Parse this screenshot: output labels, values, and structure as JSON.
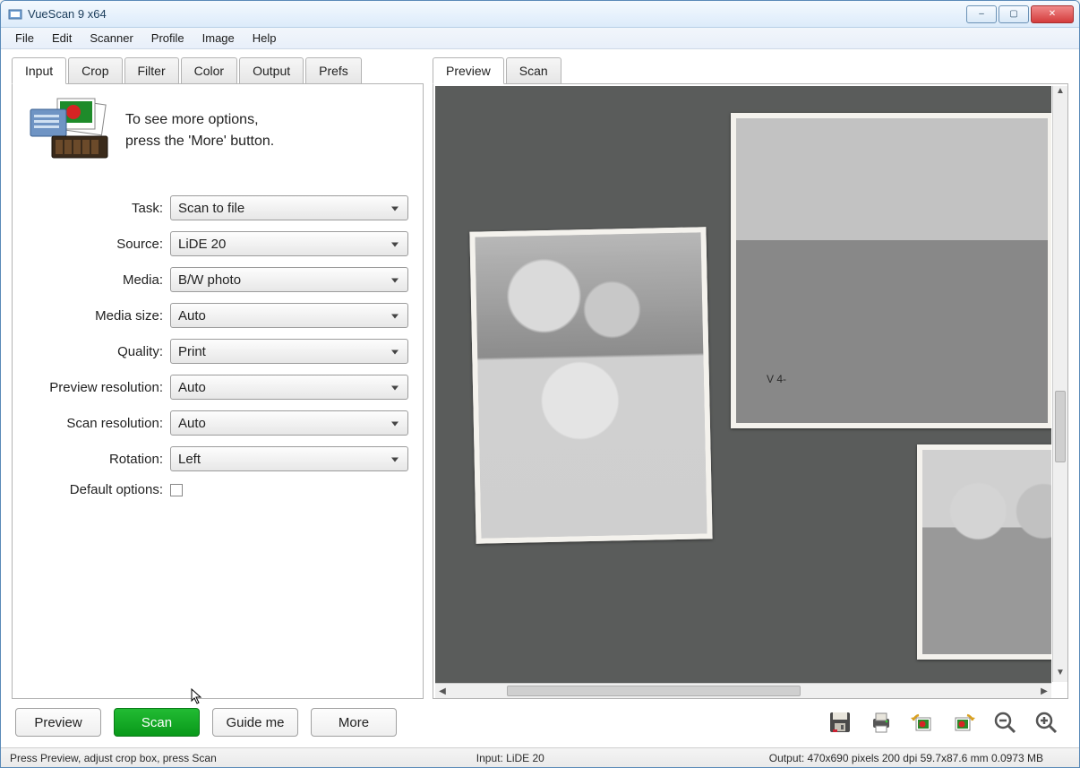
{
  "window": {
    "title": "VueScan 9 x64",
    "controls": {
      "minimize": "–",
      "maximize": "▢",
      "close": "✕"
    }
  },
  "menu": [
    "File",
    "Edit",
    "Scanner",
    "Profile",
    "Image",
    "Help"
  ],
  "left": {
    "tabs": [
      "Input",
      "Crop",
      "Filter",
      "Color",
      "Output",
      "Prefs"
    ],
    "active_tab": 0,
    "hint_line1": "To see more options,",
    "hint_line2": "press the 'More' button.",
    "fields": {
      "task": {
        "label": "Task:",
        "value": "Scan to file"
      },
      "source": {
        "label": "Source:",
        "value": "LiDE 20"
      },
      "media": {
        "label": "Media:",
        "value": "B/W photo"
      },
      "mediasz": {
        "label": "Media size:",
        "value": "Auto"
      },
      "quality": {
        "label": "Quality:",
        "value": "Print"
      },
      "prevres": {
        "label": "Preview resolution:",
        "value": "Auto"
      },
      "scanres": {
        "label": "Scan resolution:",
        "value": "Auto"
      },
      "rotation": {
        "label": "Rotation:",
        "value": "Left"
      },
      "defaults": {
        "label": "Default options:",
        "checked": false
      }
    },
    "buttons": {
      "preview": "Preview",
      "scan": "Scan",
      "guide": "Guide me",
      "more": "More"
    }
  },
  "right": {
    "tabs": [
      "Preview",
      "Scan"
    ],
    "active_tab": 0,
    "photo_label": "V 4-"
  },
  "toolbar_icons": [
    "save-icon",
    "print-icon",
    "rotate-left-icon",
    "rotate-right-icon",
    "zoom-out-icon",
    "zoom-in-icon"
  ],
  "status": {
    "left": "Press Preview, adjust crop box, press Scan",
    "mid": "Input: LiDE 20",
    "right": "Output: 470x690 pixels 200 dpi 59.7x87.6 mm 0.0973 MB"
  },
  "colors": {
    "scan_green": "#1aa82c",
    "titlebar": "#dcebfa",
    "close_red": "#d43c3c"
  }
}
